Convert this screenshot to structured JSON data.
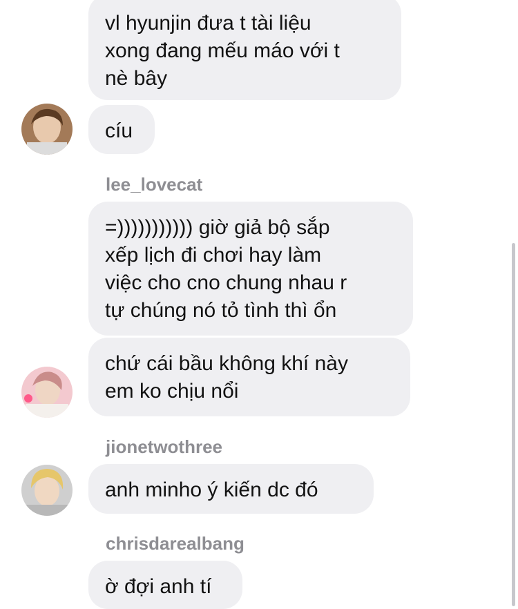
{
  "messages": [
    {
      "text": "vl hyunjin đưa t tài liệu\nxong đang mếu máo với t\nnè bây"
    },
    {
      "text": "cíu"
    },
    {
      "sender": "lee_lovecat"
    },
    {
      "text": "=))))))))))) giờ giả bộ sắp\nxếp lịch đi chơi hay làm\nviệc cho cno chung nhau r\ntự chúng nó tỏ tình thì ổn"
    },
    {
      "text": "chứ cái bầu không khí này\nem ko chịu nổi"
    },
    {
      "sender": "jionetwothree"
    },
    {
      "text": "anh minho ý kiến dc đó"
    },
    {
      "sender": "chrisdarealbang"
    },
    {
      "text": "ờ đợi anh tí"
    }
  ],
  "colors": {
    "bubble_bg": "#efeff2",
    "sender_text": "#8e8e93",
    "message_text": "#121212"
  }
}
